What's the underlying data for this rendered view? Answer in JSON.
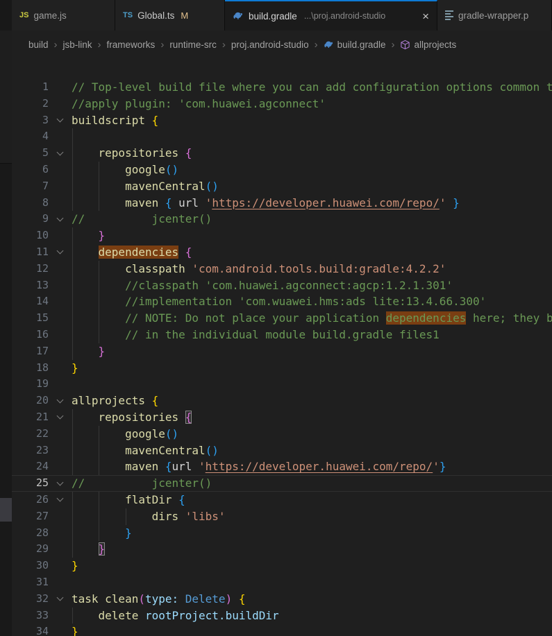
{
  "colors": {
    "editor_bg": "#1f1f1f",
    "tabbar_bg": "#181818",
    "active_tab_accent": "#0e7ad4",
    "comment": "#6a9955",
    "string": "#ce9178",
    "identifier": "#dcdcaa",
    "bracket_level1": "#ffd700",
    "bracket_level2": "#d670d6",
    "bracket_level3": "#2da0f0",
    "keyword": "#569cd6",
    "variable": "#9cdcfe",
    "word_highlight": "#7a3e12",
    "git_modified_badge": "#e2c08d",
    "gradle_icon_blue": "#4a86c8",
    "symbol_cube_purple": "#b180d7"
  },
  "tabs": [
    {
      "icon": "js-icon",
      "icon_text": "JS",
      "label": "game.js",
      "active": false
    },
    {
      "icon": "ts-icon",
      "icon_text": "TS",
      "label": "Global.ts",
      "badge": "M",
      "active": false
    },
    {
      "icon": "gradle-elephant-icon",
      "label": "build.gradle",
      "hint": "...\\proj.android-studio",
      "close": "×",
      "active": true
    },
    {
      "icon": "properties-icon",
      "label": "gradle-wrapper.p",
      "active": false
    }
  ],
  "breadcrumb": {
    "separator": "›",
    "items": [
      {
        "label": "build"
      },
      {
        "label": "jsb-link"
      },
      {
        "label": "frameworks"
      },
      {
        "label": "runtime-src"
      },
      {
        "label": "proj.android-studio"
      },
      {
        "label": "build.gradle",
        "icon": "gradle-elephant-icon"
      },
      {
        "label": "allprojects",
        "icon": "symbol-cube-icon"
      }
    ]
  },
  "editor": {
    "lines": [
      {
        "n": 1,
        "segs": [
          [
            "// Top-level build file where you can add configuration options common t",
            "cm"
          ]
        ]
      },
      {
        "n": 2,
        "segs": [
          [
            "//apply plugin: 'com.huawei.agconnect'",
            "cm"
          ]
        ]
      },
      {
        "n": 3,
        "fold": true,
        "segs": [
          [
            "buildscript ",
            "fn"
          ],
          [
            "{",
            "b1"
          ]
        ]
      },
      {
        "n": 4,
        "guides": [
          0
        ],
        "segs": []
      },
      {
        "n": 5,
        "fold": true,
        "guides": [
          0
        ],
        "segs": [
          [
            "    ",
            "wt"
          ],
          [
            "repositories ",
            "fn"
          ],
          [
            "{",
            "b2"
          ]
        ]
      },
      {
        "n": 6,
        "guides": [
          0,
          4
        ],
        "segs": [
          [
            "        ",
            "wt"
          ],
          [
            "google",
            "fn"
          ],
          [
            "()",
            "b3"
          ]
        ]
      },
      {
        "n": 7,
        "guides": [
          0,
          4
        ],
        "segs": [
          [
            "        ",
            "wt"
          ],
          [
            "mavenCentral",
            "fn"
          ],
          [
            "()",
            "b3"
          ]
        ]
      },
      {
        "n": 8,
        "guides": [
          0,
          4
        ],
        "segs": [
          [
            "        ",
            "wt"
          ],
          [
            "maven ",
            "fn"
          ],
          [
            "{",
            "b3"
          ],
          [
            " url ",
            "wt"
          ],
          [
            "'",
            "str"
          ],
          [
            "https://developer.huawei.com/repo/",
            "str u"
          ],
          [
            "'",
            "str"
          ],
          [
            " ",
            "wt"
          ],
          [
            "}",
            "b3"
          ]
        ]
      },
      {
        "n": 9,
        "fold": true,
        "segs": [
          [
            "//          jcenter()",
            "cm"
          ]
        ]
      },
      {
        "n": 10,
        "guides": [
          0
        ],
        "segs": [
          [
            "    ",
            "wt"
          ],
          [
            "}",
            "b2"
          ]
        ]
      },
      {
        "n": 11,
        "fold": true,
        "guides": [
          0
        ],
        "segs": [
          [
            "    ",
            "wt"
          ],
          [
            "dependencies",
            "fn hl"
          ],
          [
            " ",
            "wt"
          ],
          [
            "{",
            "b2"
          ]
        ]
      },
      {
        "n": 12,
        "guides": [
          0,
          4
        ],
        "segs": [
          [
            "        ",
            "wt"
          ],
          [
            "classpath ",
            "fn"
          ],
          [
            "'com.android.tools.build:gradle:4.2.2'",
            "str"
          ]
        ]
      },
      {
        "n": 13,
        "guides": [
          0,
          4
        ],
        "segs": [
          [
            "        ",
            "wt"
          ],
          [
            "//classpath 'com.huawei.agconnect:agcp:1.2.1.301'",
            "cm"
          ]
        ]
      },
      {
        "n": 14,
        "guides": [
          0,
          4
        ],
        "segs": [
          [
            "        ",
            "wt"
          ],
          [
            "//implementation 'com.wuawei.hms:ads lite:13.4.66.300'",
            "cm"
          ]
        ]
      },
      {
        "n": 15,
        "guides": [
          0,
          4
        ],
        "segs": [
          [
            "        ",
            "wt"
          ],
          [
            "// NOTE: Do not place your application ",
            "cm"
          ],
          [
            "dependencies",
            "cm hl"
          ],
          [
            " here; they b",
            "cm"
          ]
        ]
      },
      {
        "n": 16,
        "guides": [
          0,
          4
        ],
        "segs": [
          [
            "        ",
            "wt"
          ],
          [
            "// in the individual module build.gradle files1",
            "cm"
          ]
        ]
      },
      {
        "n": 17,
        "guides": [
          0
        ],
        "segs": [
          [
            "    ",
            "wt"
          ],
          [
            "}",
            "b2"
          ]
        ]
      },
      {
        "n": 18,
        "segs": [
          [
            "}",
            "b1"
          ]
        ]
      },
      {
        "n": 19,
        "segs": []
      },
      {
        "n": 20,
        "fold": true,
        "segs": [
          [
            "allprojects ",
            "fn"
          ],
          [
            "{",
            "b1"
          ]
        ]
      },
      {
        "n": 21,
        "fold": true,
        "guides": [
          0
        ],
        "segs": [
          [
            "    ",
            "wt"
          ],
          [
            "repositories ",
            "fn"
          ],
          [
            "{",
            "b2 box"
          ]
        ]
      },
      {
        "n": 22,
        "guides": [
          0,
          4
        ],
        "segs": [
          [
            "        ",
            "wt"
          ],
          [
            "google",
            "fn"
          ],
          [
            "()",
            "b3"
          ]
        ]
      },
      {
        "n": 23,
        "guides": [
          0,
          4
        ],
        "segs": [
          [
            "        ",
            "wt"
          ],
          [
            "mavenCentral",
            "fn"
          ],
          [
            "()",
            "b3"
          ]
        ]
      },
      {
        "n": 24,
        "guides": [
          0,
          4
        ],
        "segs": [
          [
            "        ",
            "wt"
          ],
          [
            "maven ",
            "fn"
          ],
          [
            "{",
            "b3"
          ],
          [
            "url ",
            "wt"
          ],
          [
            "'",
            "str"
          ],
          [
            "https://developer.huawei.com/repo/",
            "str u"
          ],
          [
            "'",
            "str"
          ],
          [
            "}",
            "b3"
          ]
        ]
      },
      {
        "n": 25,
        "fold": true,
        "cur": true,
        "segs": [
          [
            "//          jcenter()",
            "cm"
          ]
        ]
      },
      {
        "n": 26,
        "fold": true,
        "guides": [
          0,
          4
        ],
        "segs": [
          [
            "        ",
            "wt"
          ],
          [
            "flatDir ",
            "fn"
          ],
          [
            "{",
            "b3"
          ]
        ]
      },
      {
        "n": 27,
        "guides": [
          0,
          4,
          8
        ],
        "segs": [
          [
            "            ",
            "wt"
          ],
          [
            "dirs ",
            "fn"
          ],
          [
            "'libs'",
            "str"
          ]
        ]
      },
      {
        "n": 28,
        "guides": [
          0,
          4
        ],
        "segs": [
          [
            "        ",
            "wt"
          ],
          [
            "}",
            "b3"
          ]
        ]
      },
      {
        "n": 29,
        "guides": [
          0
        ],
        "segs": [
          [
            "    ",
            "wt"
          ],
          [
            "}",
            "b2 box"
          ]
        ]
      },
      {
        "n": 30,
        "segs": [
          [
            "}",
            "b1"
          ]
        ]
      },
      {
        "n": 31,
        "segs": []
      },
      {
        "n": 32,
        "fold": true,
        "segs": [
          [
            "task clean",
            "fn"
          ],
          [
            "(",
            "b2"
          ],
          [
            "type: ",
            "var"
          ],
          [
            "Delete",
            "kw"
          ],
          [
            ")",
            "b2"
          ],
          [
            " ",
            "wt"
          ],
          [
            "{",
            "b1"
          ]
        ]
      },
      {
        "n": 33,
        "guides": [
          0
        ],
        "segs": [
          [
            "    ",
            "wt"
          ],
          [
            "delete ",
            "fn"
          ],
          [
            "rootProject.buildDir",
            "var"
          ]
        ]
      },
      {
        "n": 34,
        "segs": [
          [
            "}",
            "b1"
          ]
        ]
      }
    ]
  }
}
